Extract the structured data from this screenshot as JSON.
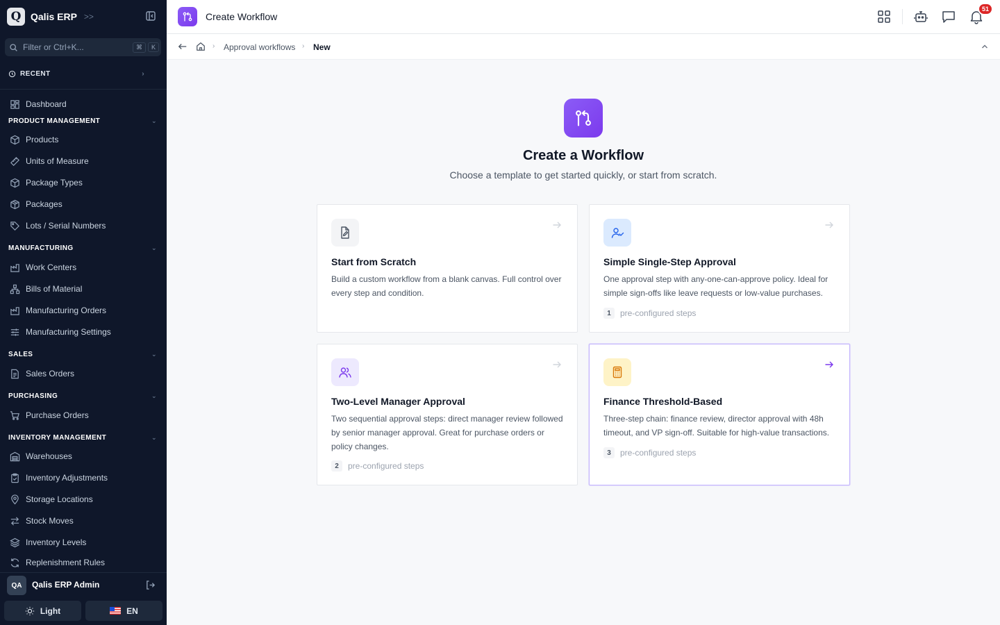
{
  "app": {
    "logo_letter": "Q",
    "name": "Qalis ERP",
    "brand_chevron": ">>"
  },
  "sidebar": {
    "search": {
      "placeholder": "Filter or Ctrl+K...",
      "value": "",
      "kbd_mod": "⌘",
      "kbd_key": "K"
    },
    "recent_label": "RECENT",
    "dashboard": "Dashboard",
    "sections": [
      {
        "title": "PRODUCT MANAGEMENT",
        "items": [
          "Products",
          "Units of Measure",
          "Package Types",
          "Packages",
          "Lots / Serial Numbers"
        ]
      },
      {
        "title": "MANUFACTURING",
        "items": [
          "Work Centers",
          "Bills of Material",
          "Manufacturing Orders",
          "Manufacturing Settings"
        ]
      },
      {
        "title": "SALES",
        "items": [
          "Sales Orders"
        ]
      },
      {
        "title": "PURCHASING",
        "items": [
          "Purchase Orders"
        ]
      },
      {
        "title": "INVENTORY MANAGEMENT",
        "items": [
          "Warehouses",
          "Inventory Adjustments",
          "Storage Locations",
          "Stock Moves",
          "Inventory Levels",
          "Replenishment Rules"
        ]
      }
    ],
    "user": {
      "initials": "QA",
      "name": "Qalis ERP Admin"
    },
    "theme_label": "Light",
    "language_label": "EN"
  },
  "topbar": {
    "title": "Create Workflow",
    "notification_count": "51"
  },
  "breadcrumb": {
    "parent": "Approval workflows",
    "current": "New"
  },
  "main": {
    "title": "Create a Workflow",
    "subtitle": "Choose a template to get started quickly, or start from scratch.",
    "templates": [
      {
        "title": "Start from Scratch",
        "description": "Build a custom workflow from a blank canvas. Full control over every step and condition.",
        "icon": "file-pen-icon",
        "icon_bg": "#f3f4f6",
        "icon_color": "#4b5563"
      },
      {
        "title": "Simple Single-Step Approval",
        "description": "One approval step with any-one-can-approve policy. Ideal for simple sign-offs like leave requests or low-value purchases.",
        "steps": "1",
        "steps_label": "pre-configured steps",
        "icon": "user-check-icon",
        "icon_bg": "#dbeafe",
        "icon_color": "#2563eb"
      },
      {
        "title": "Two-Level Manager Approval",
        "description": "Two sequential approval steps: direct manager review followed by senior manager approval. Great for purchase orders or policy changes.",
        "steps": "2",
        "steps_label": "pre-configured steps",
        "icon": "users-icon",
        "icon_bg": "#ede9fe",
        "icon_color": "#7c3aed"
      },
      {
        "title": "Finance Threshold-Based",
        "description": "Three-step chain: finance review, director approval with 48h timeout, and VP sign-off. Suitable for high-value transactions.",
        "steps": "3",
        "steps_label": "pre-configured steps",
        "icon": "calculator-icon",
        "icon_bg": "#fef3c7",
        "icon_color": "#d97706"
      }
    ]
  },
  "colors": {
    "accent": "#7c3aed",
    "sidebar_bg": "#0f172a",
    "badge": "#dc2626"
  }
}
